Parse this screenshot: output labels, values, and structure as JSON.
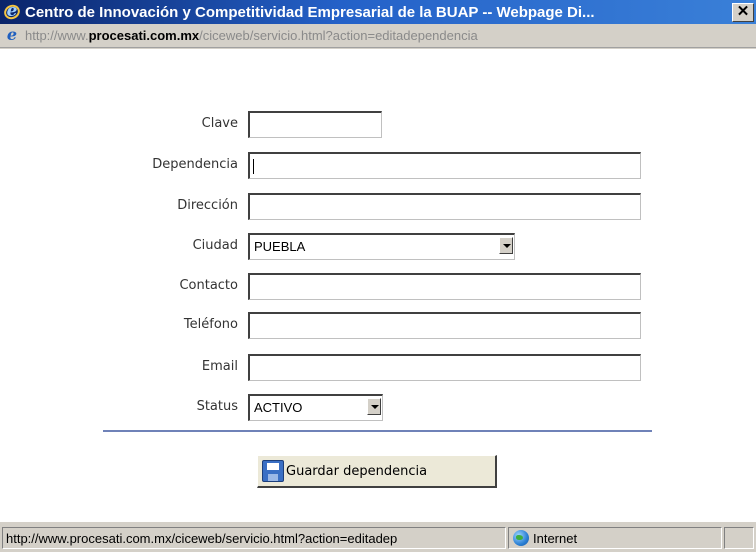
{
  "window": {
    "title": "Centro de Innovación y Competitividad Empresarial de la BUAP -- Webpage Di...",
    "close_glyph": "✕"
  },
  "address": {
    "url_prefix": "http://www.",
    "url_domain": "procesati.com.mx",
    "url_path": "/ciceweb/servicio.html?action=editadependencia"
  },
  "form": {
    "clave": {
      "label": "Clave",
      "value": ""
    },
    "dependencia": {
      "label": "Dependencia",
      "value": ""
    },
    "direccion": {
      "label": "Dirección",
      "value": ""
    },
    "ciudad": {
      "label": "Ciudad",
      "value": "PUEBLA"
    },
    "contacto": {
      "label": "Contacto",
      "value": ""
    },
    "telefono": {
      "label": "Teléfono",
      "value": ""
    },
    "email": {
      "label": "Email",
      "value": ""
    },
    "status": {
      "label": "Status",
      "value": "ACTIVO"
    },
    "save_label": "Guardar dependencia"
  },
  "statusbar": {
    "url": "http://www.procesati.com.mx/ciceweb/servicio.html?action=editadep",
    "zone": "Internet"
  },
  "icons": {
    "window": "ie-icon",
    "page": "ie-page-icon",
    "save": "floppy-disk-icon",
    "zone": "globe-icon"
  }
}
